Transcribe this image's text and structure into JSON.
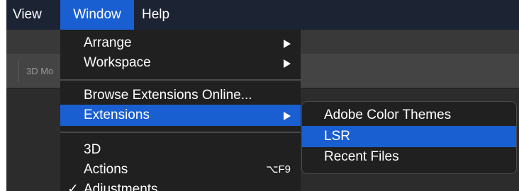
{
  "menubar": {
    "items": [
      {
        "label": "View"
      },
      {
        "label": "Window"
      },
      {
        "label": "Help"
      }
    ]
  },
  "options_bar": {
    "field_text": "3D Mo"
  },
  "window_menu": {
    "items": [
      {
        "label": "Arrange",
        "submenu": true
      },
      {
        "label": "Workspace",
        "submenu": true
      },
      {
        "label": "Browse Extensions Online..."
      },
      {
        "label": "Extensions",
        "submenu": true,
        "selected": true
      },
      {
        "label": "3D"
      },
      {
        "label": "Actions",
        "shortcut": "⌥F9"
      },
      {
        "label": "Adjustments",
        "checked": true,
        "check_mark": "✓"
      }
    ]
  },
  "extensions_submenu": {
    "items": [
      {
        "label": "Adobe Color Themes"
      },
      {
        "label": "LSR",
        "selected": true
      },
      {
        "label": "Recent Files"
      }
    ]
  },
  "colors": {
    "menubar_bg": "#1c2333",
    "selection": "#1a5fd1",
    "menu_bg": "#202020"
  }
}
